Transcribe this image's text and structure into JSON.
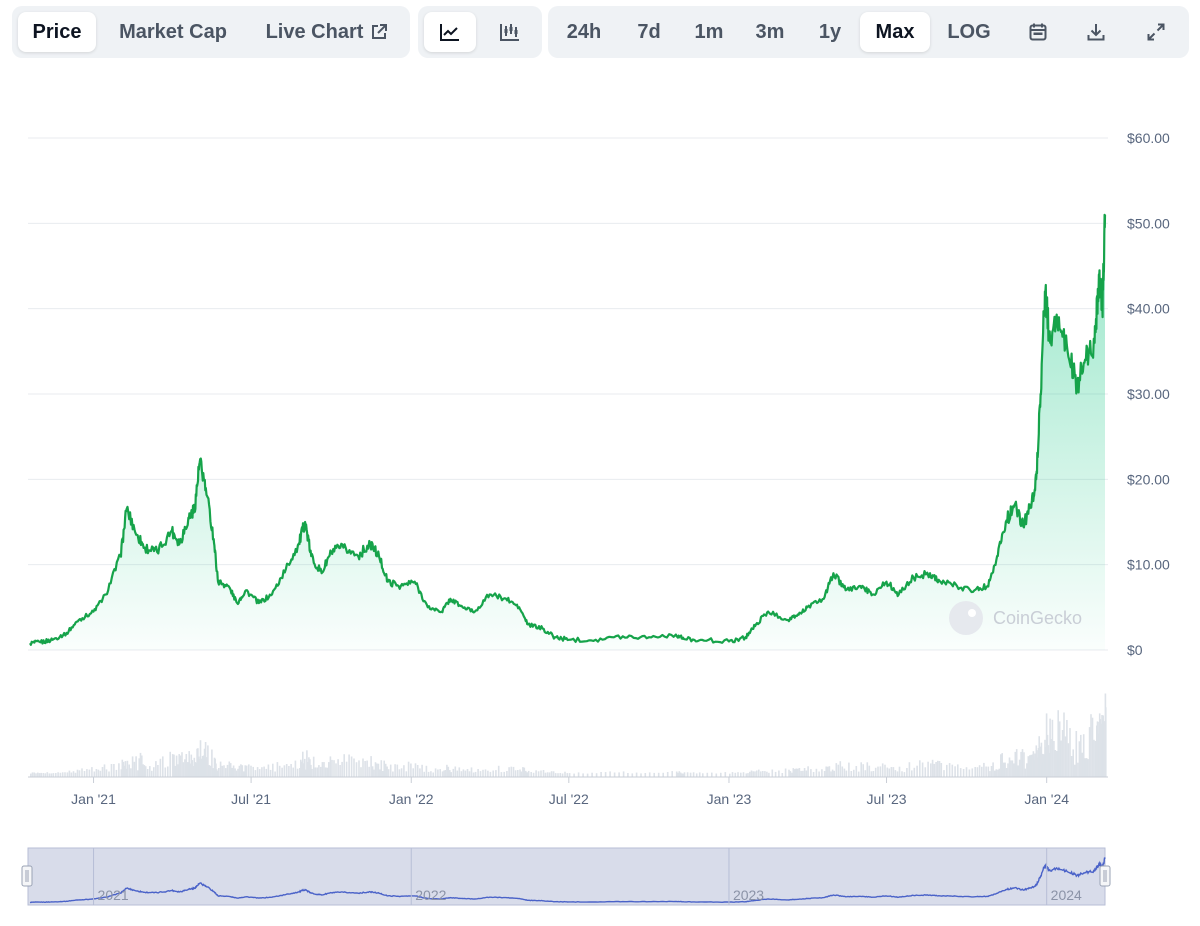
{
  "toolbar": {
    "tabs": [
      {
        "label": "Price",
        "active": true
      },
      {
        "label": "Market Cap",
        "active": false
      },
      {
        "label": "Live Chart",
        "active": false
      }
    ],
    "chart_types": [
      {
        "icon": "line-chart-icon",
        "active": true
      },
      {
        "icon": "candlestick-chart-icon",
        "active": false
      }
    ],
    "ranges": [
      {
        "label": "24h",
        "active": false
      },
      {
        "label": "7d",
        "active": false
      },
      {
        "label": "1m",
        "active": false
      },
      {
        "label": "3m",
        "active": false
      },
      {
        "label": "1y",
        "active": false
      },
      {
        "label": "Max",
        "active": true
      }
    ],
    "log_label": "LOG",
    "icons": [
      "calendar-icon",
      "download-icon",
      "expand-icon"
    ]
  },
  "watermark": "CoinGecko",
  "colors": {
    "line": "#16a34a",
    "fill": "#16c784",
    "volume": "#dde2e8",
    "navigator": "#4a62c8",
    "navigator_bg": "#d8dcea"
  },
  "chart_data": {
    "type": "area",
    "title": "",
    "xlabel": "",
    "ylabel": "",
    "ylim": [
      0,
      60
    ],
    "yticks": [
      0,
      10,
      20,
      30,
      40,
      50,
      60
    ],
    "ytick_labels": [
      "$0",
      "$10.00",
      "$20.00",
      "$30.00",
      "$40.00",
      "$50.00",
      "$60.00"
    ],
    "grid": true,
    "xticks": [
      {
        "date": "2021-01-01",
        "label": "Jan '21"
      },
      {
        "date": "2021-07-01",
        "label": "Jul '21"
      },
      {
        "date": "2022-01-01",
        "label": "Jan '22"
      },
      {
        "date": "2022-07-01",
        "label": "Jul '22"
      },
      {
        "date": "2023-01-01",
        "label": "Jan '23"
      },
      {
        "date": "2023-07-01",
        "label": "Jul '23"
      },
      {
        "date": "2024-01-01",
        "label": "Jan '24"
      }
    ],
    "series": [
      {
        "points": [
          [
            "2020-10-20",
            0.8
          ],
          [
            "2020-11-01",
            0.9
          ],
          [
            "2020-11-15",
            1.2
          ],
          [
            "2020-12-01",
            2.0
          ],
          [
            "2020-12-15",
            3.5
          ],
          [
            "2021-01-01",
            4.5
          ],
          [
            "2021-01-15",
            6.5
          ],
          [
            "2021-02-01",
            11.0
          ],
          [
            "2021-02-08",
            16.5
          ],
          [
            "2021-02-20",
            13.5
          ],
          [
            "2021-03-01",
            12.0
          ],
          [
            "2021-03-15",
            11.5
          ],
          [
            "2021-04-01",
            14.0
          ],
          [
            "2021-04-10",
            12.5
          ],
          [
            "2021-04-20",
            15.5
          ],
          [
            "2021-04-27",
            16.5
          ],
          [
            "2021-05-03",
            22.0
          ],
          [
            "2021-05-10",
            19.0
          ],
          [
            "2021-05-19",
            13.0
          ],
          [
            "2021-05-24",
            8.0
          ],
          [
            "2021-06-05",
            7.5
          ],
          [
            "2021-06-15",
            5.5
          ],
          [
            "2021-06-25",
            7.0
          ],
          [
            "2021-07-10",
            5.5
          ],
          [
            "2021-07-25",
            6.5
          ],
          [
            "2021-08-10",
            9.5
          ],
          [
            "2021-08-25",
            12.5
          ],
          [
            "2021-09-01",
            15.0
          ],
          [
            "2021-09-08",
            11.0
          ],
          [
            "2021-09-20",
            9.0
          ],
          [
            "2021-10-01",
            11.5
          ],
          [
            "2021-10-15",
            12.0
          ],
          [
            "2021-11-01",
            11.0
          ],
          [
            "2021-11-15",
            12.5
          ],
          [
            "2021-11-25",
            11.0
          ],
          [
            "2021-12-05",
            8.0
          ],
          [
            "2021-12-20",
            7.5
          ],
          [
            "2022-01-05",
            8.0
          ],
          [
            "2022-01-20",
            5.0
          ],
          [
            "2022-02-05",
            4.5
          ],
          [
            "2022-02-15",
            6.0
          ],
          [
            "2022-03-01",
            5.0
          ],
          [
            "2022-03-15",
            4.5
          ],
          [
            "2022-04-01",
            6.5
          ],
          [
            "2022-04-20",
            6.0
          ],
          [
            "2022-05-05",
            5.0
          ],
          [
            "2022-05-15",
            3.0
          ],
          [
            "2022-06-01",
            2.5
          ],
          [
            "2022-06-15",
            1.5
          ],
          [
            "2022-07-01",
            1.2
          ],
          [
            "2022-08-01",
            1.2
          ],
          [
            "2022-09-01",
            1.6
          ],
          [
            "2022-10-01",
            1.5
          ],
          [
            "2022-11-01",
            1.8
          ],
          [
            "2022-11-10",
            1.3
          ],
          [
            "2022-12-01",
            1.2
          ],
          [
            "2023-01-01",
            1.0
          ],
          [
            "2023-01-20",
            1.5
          ],
          [
            "2023-02-01",
            3.0
          ],
          [
            "2023-02-15",
            4.5
          ],
          [
            "2023-03-10",
            3.5
          ],
          [
            "2023-03-20",
            4.0
          ],
          [
            "2023-04-01",
            5.0
          ],
          [
            "2023-04-20",
            6.0
          ],
          [
            "2023-05-01",
            9.0
          ],
          [
            "2023-05-15",
            7.0
          ],
          [
            "2023-06-01",
            7.5
          ],
          [
            "2023-06-15",
            6.5
          ],
          [
            "2023-07-01",
            8.0
          ],
          [
            "2023-07-15",
            6.5
          ],
          [
            "2023-08-01",
            8.5
          ],
          [
            "2023-08-20",
            9.0
          ],
          [
            "2023-09-01",
            8.0
          ],
          [
            "2023-09-20",
            7.5
          ],
          [
            "2023-10-10",
            7.0
          ],
          [
            "2023-10-25",
            7.5
          ],
          [
            "2023-11-05",
            11.0
          ],
          [
            "2023-11-15",
            15.0
          ],
          [
            "2023-11-25",
            17.0
          ],
          [
            "2023-12-05",
            14.5
          ],
          [
            "2023-12-15",
            17.5
          ],
          [
            "2023-12-20",
            20.0
          ],
          [
            "2023-12-25",
            30.0
          ],
          [
            "2023-12-30",
            42.0
          ],
          [
            "2024-01-05",
            36.0
          ],
          [
            "2024-01-15",
            39.0
          ],
          [
            "2024-01-25",
            35.0
          ],
          [
            "2024-02-05",
            31.0
          ],
          [
            "2024-02-15",
            34.0
          ],
          [
            "2024-02-25",
            36.0
          ],
          [
            "2024-03-01",
            44.0
          ],
          [
            "2024-03-05",
            40.0
          ],
          [
            "2024-03-08",
            51.0
          ]
        ]
      }
    ],
    "navigator": {
      "labels": [
        "2021",
        "2022",
        "2023",
        "2024"
      ]
    }
  }
}
